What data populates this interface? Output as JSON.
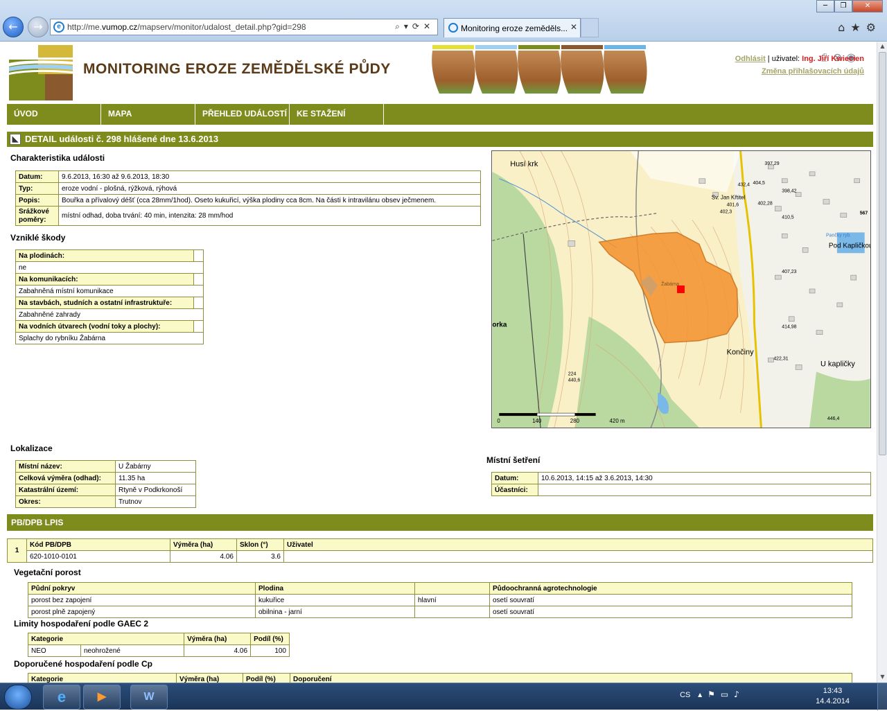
{
  "browser": {
    "url_prefix": "http://me.",
    "url_domain": "vumop.cz",
    "url_path": "/mapserv/monitor/udalost_detail.php?gid=298",
    "tab_title": "Monitoring eroze zeměděls..."
  },
  "header": {
    "site_title": "MONITORING EROZE ZEMĚDĚLSKÉ PŮDY",
    "logout": "Odhlásit",
    "user_label": " | uživatel: ",
    "user_name": "Ing. Jiří Kwiecien",
    "change_login": "Změna přihlašovacích údajů"
  },
  "menu": [
    "ÚVOD",
    "MAPA",
    "PŘEHLED UDÁLOSTÍ",
    "KE STAŽENÍ"
  ],
  "detail": {
    "title": "DETAIL události č. 298   hlášené dne 13.6.2013"
  },
  "characteristics": {
    "heading": "Charakteristika události",
    "rows": [
      {
        "label": "Datum:",
        "value": "9.6.2013, 16:30 až 9.6.2013, 18:30"
      },
      {
        "label": "Typ:",
        "value": "eroze vodní - plošná, rýžková, rýhová"
      },
      {
        "label": "Popis:",
        "value": "Bouřka a přívalový déšť (cca 28mm/1hod). Oseto kukuřicí, výška plodiny cca 8cm. Na části k intravilánu obsev ječmenem."
      },
      {
        "label": "Srážkové poměry:",
        "value": "místní odhad, doba trvání: 40 min, intenzita: 28 mm/hod"
      }
    ]
  },
  "damages": {
    "heading": "Vzniklé škody",
    "items": [
      {
        "label": "Na plodinách:",
        "value": "ne"
      },
      {
        "label": "Na komunikacích:",
        "value": "Zabahněná místní komunikace"
      },
      {
        "label": "Na stavbách, studních a ostatní infrastruktuře:",
        "value": "Zabahněné zahrady"
      },
      {
        "label": "Na vodních útvarech (vodní toky a plochy):",
        "value": "Splachy do rybníku Žabárna"
      }
    ]
  },
  "map": {
    "labels": [
      "Husí krk",
      "Sv. Jan Křtitel",
      "Pod Kapličkou",
      "Pančky ryb.",
      "Končiny",
      "U kapličky",
      "Žabárna",
      "orka"
    ],
    "numbers": [
      "404,5",
      "432,4",
      "397,29",
      "398,42",
      "402,28",
      "401,6",
      "402,3",
      "410,5",
      "407,23",
      "414,98",
      "422,31",
      "224",
      "440,6",
      "446,4",
      "567"
    ],
    "scale": [
      "0",
      "140",
      "280",
      "420 m"
    ]
  },
  "location": {
    "heading": "Lokalizace",
    "rows": [
      {
        "label": "Místní název:",
        "value": "U Žabárny"
      },
      {
        "label": "Celková výměra (odhad):",
        "value": "11.35 ha"
      },
      {
        "label": "Katastrální území:",
        "value": "Rtyně v Podkrkonoší"
      },
      {
        "label": "Okres:",
        "value": "Trutnov"
      }
    ]
  },
  "inspection": {
    "heading": "Místní šetření",
    "rows": [
      {
        "label": "Datum:",
        "value": "10.6.2013, 14:15 až 3.6.2013, 14:30"
      },
      {
        "label": "Účastníci:",
        "value": ""
      }
    ]
  },
  "lpis": {
    "heading": "PB/DPB LPIS",
    "row_index": "1",
    "columns": [
      "Kód PB/DPB",
      "Výměra (ha)",
      "Sklon (°)",
      "Uživatel"
    ],
    "values": [
      "620-1010-0101",
      "4.06",
      "3.6",
      ""
    ]
  },
  "vegetation": {
    "heading": "Vegetační porost",
    "columns": [
      "Půdní pokryv",
      "Plodina",
      "",
      "Půdoochranná agrotechnologie"
    ],
    "rows": [
      [
        "porost bez zapojení",
        "kukuřice",
        "hlavní",
        "osetí souvratí"
      ],
      [
        "porost plně zapojený",
        "obilnina - jarní",
        "",
        "osetí souvratí"
      ]
    ]
  },
  "gaec": {
    "heading": "Limity hospodaření podle GAEC 2",
    "columns": [
      "Kategorie",
      "",
      "Výměra (ha)",
      "Podíl (%)"
    ],
    "rows": [
      [
        "NEO",
        "neohrožené",
        "4.06",
        "100"
      ]
    ]
  },
  "cp": {
    "heading": "Doporučené hospodaření podle Cp",
    "columns": [
      "Kategorie",
      "Výměra (ha)",
      "Podíl (%)",
      "Doporučení"
    ]
  },
  "taskbar": {
    "lang": "CS",
    "time": "13:43",
    "date": "14.4.2014"
  },
  "colors": {
    "menu_green": "#7d8c1d",
    "label_yellow": "#fafac8",
    "erosion_orange": "#f5922e"
  }
}
